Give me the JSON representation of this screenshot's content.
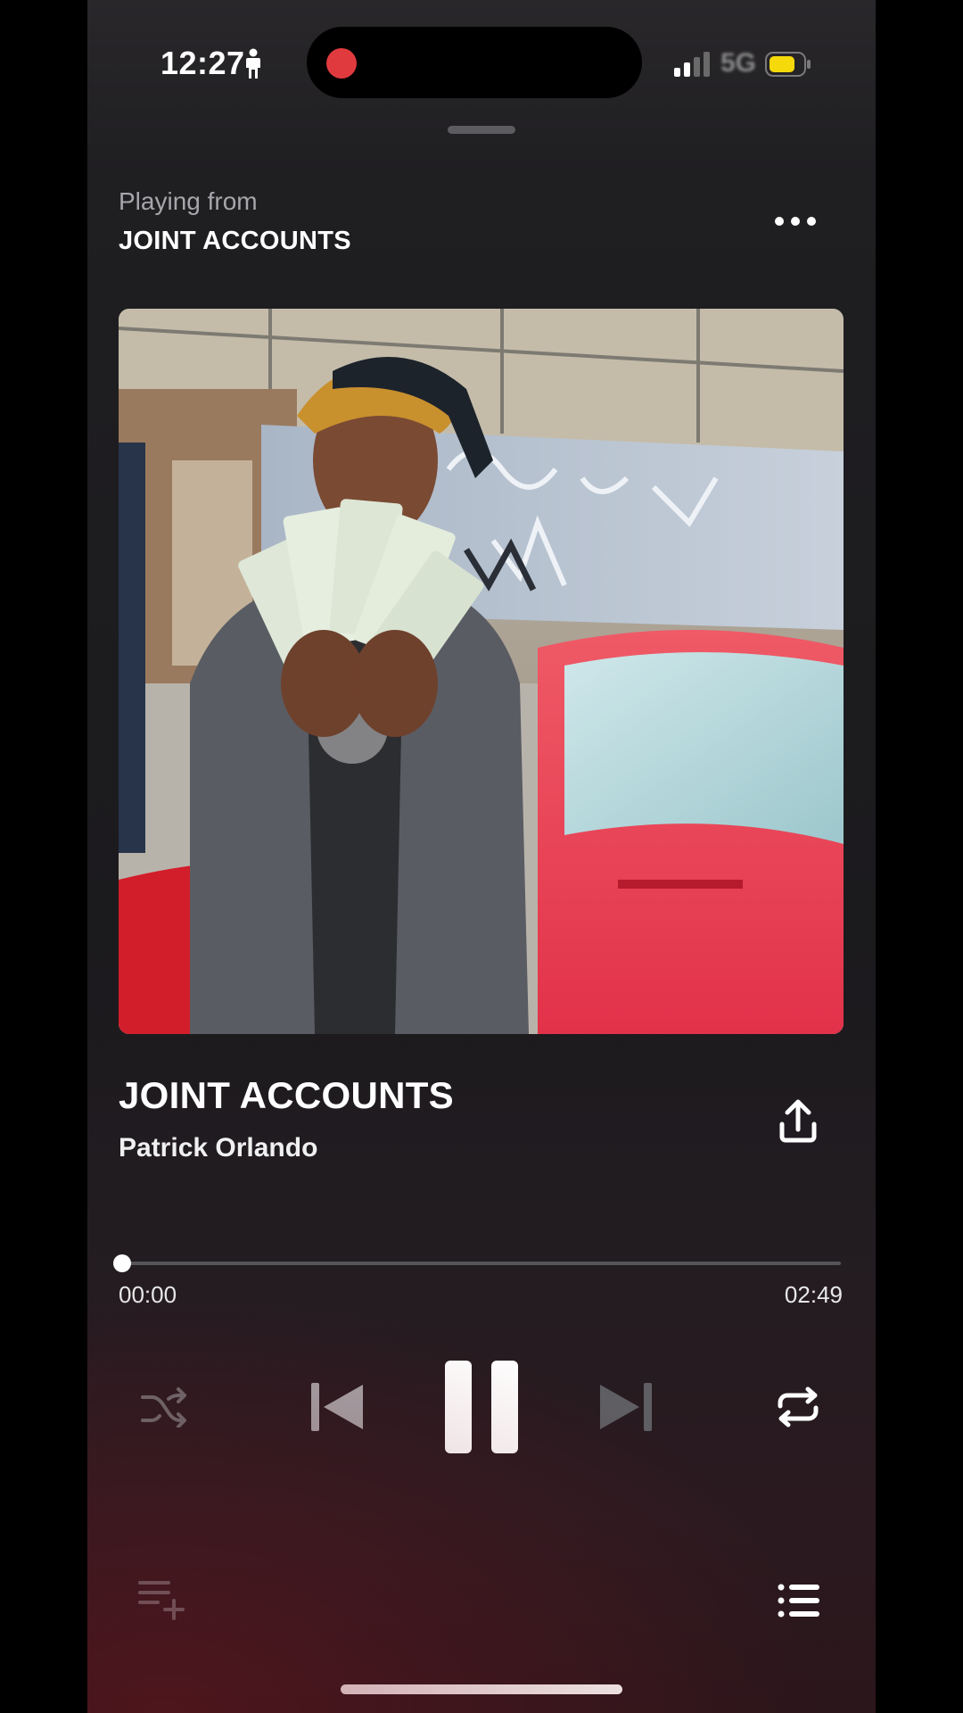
{
  "status_bar": {
    "time": "12:27",
    "network": "5G",
    "recording_color": "#e03a3f",
    "battery_color": "#f5d90a"
  },
  "header": {
    "playing_from_label": "Playing from",
    "playlist_name": "JOINT ACCOUNTS",
    "more_icon": "more-horizontal-icon"
  },
  "track": {
    "title": "JOINT ACCOUNTS",
    "artist": "Patrick Orlando",
    "share_icon": "share-upload-icon"
  },
  "playback": {
    "current_time": "00:00",
    "total_time": "02:49",
    "progress_fraction": 0.0,
    "state": "playing"
  },
  "controls": {
    "shuffle_icon": "shuffle-icon",
    "previous_icon": "skip-previous-icon",
    "pause_icon": "pause-icon",
    "next_icon": "skip-next-icon",
    "repeat_icon": "repeat-icon",
    "add_to_queue_icon": "playlist-add-icon",
    "queue_icon": "queue-list-icon"
  }
}
